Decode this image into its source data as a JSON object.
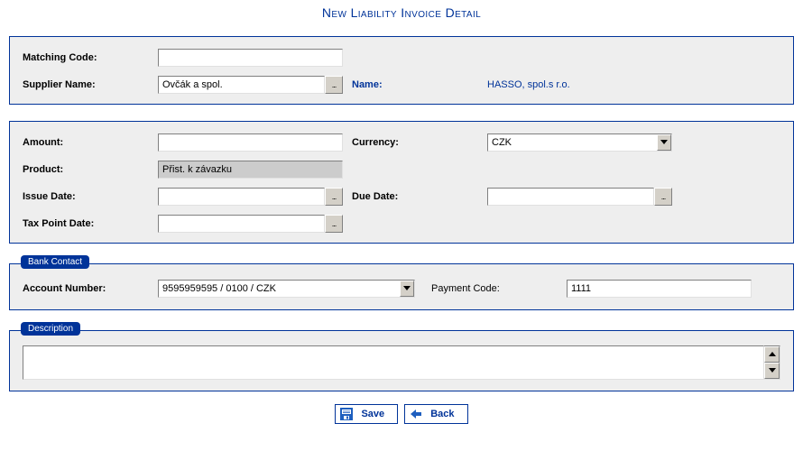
{
  "page_title": "New Liability Invoice Detail",
  "section1": {
    "matching_code_label": "Matching Code:",
    "matching_code_value": "",
    "supplier_label": "Supplier Name:",
    "supplier_value": "Ovčák a spol.",
    "name_label": "Name:",
    "name_value": "HASSO, spol.s r.o."
  },
  "section2": {
    "amount_label": "Amount:",
    "amount_value": "",
    "currency_label": "Currency:",
    "currency_value": "CZK",
    "product_label": "Product:",
    "product_value": "Přist. k závazku",
    "issue_date_label": "Issue Date:",
    "issue_date_value": "",
    "due_date_label": "Due Date:",
    "due_date_value": "",
    "tax_point_label": "Tax Point Date:",
    "tax_point_value": ""
  },
  "bank": {
    "legend": "Bank Contact",
    "account_label": "Account Number:",
    "account_value": "9595959595 / 0100 / CZK",
    "payment_code_label": "Payment Code:",
    "payment_code_value": "1111"
  },
  "desc": {
    "legend": "Description",
    "value": ""
  },
  "buttons": {
    "save_label": "Save",
    "back_label": "Back"
  },
  "icons": {
    "ellipsis": "..."
  }
}
